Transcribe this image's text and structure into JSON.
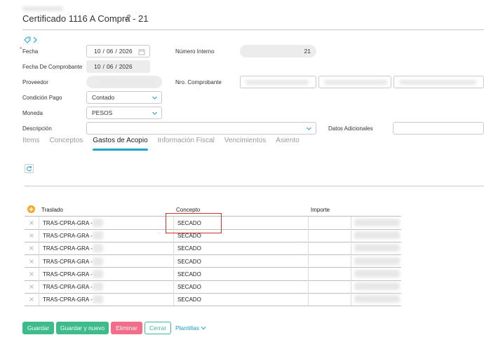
{
  "header": {
    "title": "Certificado 1116 A Compra - 21"
  },
  "form": {
    "fecha_label": "Fecha",
    "fecha_day": "10",
    "fecha_month": "06",
    "fecha_year": "2026",
    "fecha_comprobante_label": "Fecha De Comprobante",
    "fecha_comprobante_day": "10",
    "fecha_comprobante_month": "06",
    "fecha_comprobante_year": "2026",
    "proveedor_label": "Proveedor",
    "condicion_label": "Condición Pago",
    "condicion_value": "Contado",
    "moneda_label": "Moneda",
    "moneda_value": "PESOS",
    "descripcion_label": "Descripción",
    "numero_interno_label": "Número Interno",
    "numero_interno_value": "21",
    "nro_comprobante_label": "Nro. Comprobante",
    "datos_adicionales_label": "Datos Adicionales",
    "required_mark": "*"
  },
  "tabs": [
    {
      "label": "Items",
      "active": false
    },
    {
      "label": "Conceptos",
      "active": false
    },
    {
      "label": "Gastos de Acopio",
      "active": true
    },
    {
      "label": "Información Fiscal",
      "active": false
    },
    {
      "label": "Vencimientos",
      "active": false
    },
    {
      "label": "Asiento",
      "active": false
    }
  ],
  "table": {
    "headers": {
      "traslado": "Traslado",
      "concepto": "Concepto",
      "importe": "Importe"
    },
    "rows": [
      {
        "traslado": "TRAS-CPRA-GRA -",
        "concepto": "SECADO"
      },
      {
        "traslado": "TRAS-CPRA-GRA -",
        "concepto": "SECADO"
      },
      {
        "traslado": "TRAS-CPRA-GRA -",
        "concepto": "SECADO"
      },
      {
        "traslado": "TRAS-CPRA-GRA -",
        "concepto": "SECADO"
      },
      {
        "traslado": "TRAS-CPRA-GRA -",
        "concepto": "SECADO"
      },
      {
        "traslado": "TRAS-CPRA-GRA -",
        "concepto": "SECADO"
      },
      {
        "traslado": "TRAS-CPRA-GRA -",
        "concepto": "SECADO"
      }
    ]
  },
  "footer": {
    "guardar": "Guardar",
    "guardar_nuevo": "Guardar y nuevo",
    "eliminar": "Eliminar",
    "cerrar": "Cerrar",
    "plantillas": "Plantillas"
  },
  "colors": {
    "accent": "#1fa3c9",
    "green": "#3dbb8a",
    "red": "#f26d8a",
    "highlight": "#d32f2f",
    "add": "#f5a623"
  }
}
